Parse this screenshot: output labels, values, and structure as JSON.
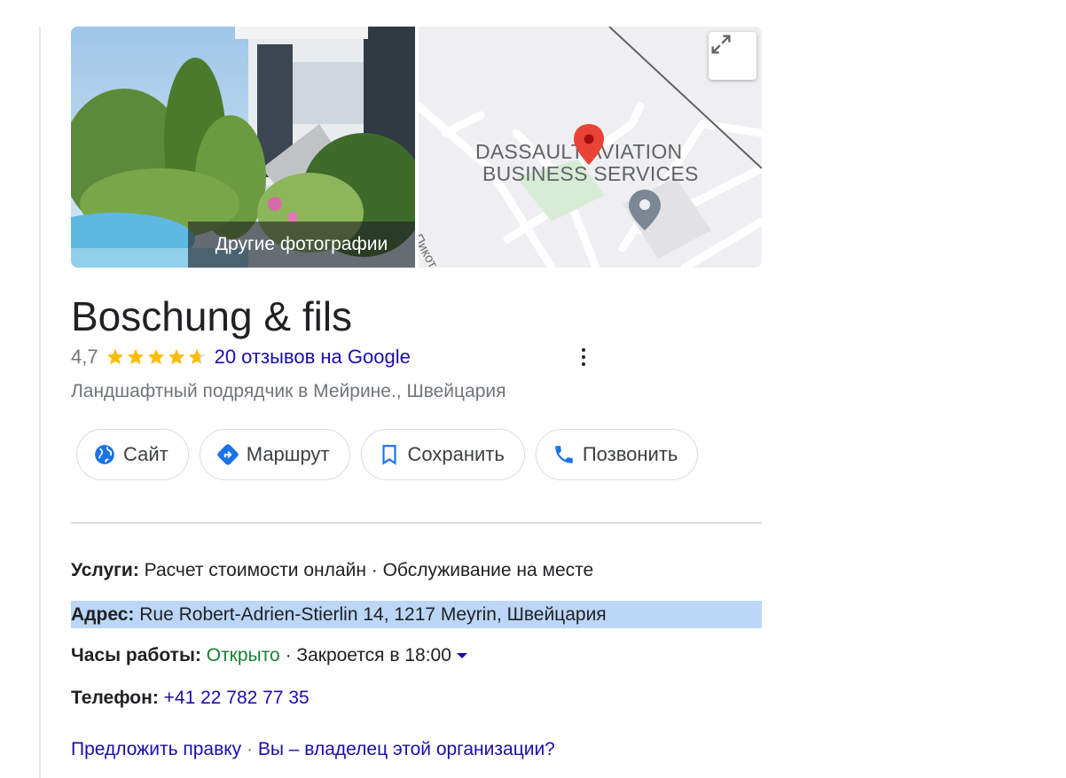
{
  "photo": {
    "label": "Другие фотографии"
  },
  "map": {
    "label_line1": "DASSAULT AVIATION",
    "label_line2": "BUSINESS SERVICES",
    "street": "ул. Пикот",
    "pin_color": "#ea4335"
  },
  "business": {
    "name": "Boschung & fils",
    "rating": "4,7",
    "stars_value": 4.7,
    "reviews": "20 отзывов на Google",
    "category": "Ландшафтный подрядчик в Мейрине., Швейцария"
  },
  "actions": {
    "site": "Сайт",
    "route": "Маршрут",
    "save": "Сохранить",
    "call": "Позвонить"
  },
  "details": {
    "services_label": "Услуги:",
    "services_value": "Расчет стоимости онлайн · Обслуживание на месте",
    "address_label": "Адрес:",
    "address_value": "Rue Robert-Adrien-Stierlin 14, 1217 Meyrin, Швейцария",
    "hours_label": "Часы работы:",
    "hours_open": "Открыто",
    "hours_close": "· Закроется в 18:00",
    "phone_label": "Телефон:",
    "phone_value": "+41 22 782 77 35"
  },
  "footer": {
    "suggest": "Предложить правку",
    "sep": "·",
    "owner": "Вы – владелец этой организации?"
  },
  "colors": {
    "link": "#1a0dab",
    "open": "#188038",
    "star": "#fbbc04",
    "highlight": "#bcd6f7",
    "icon_blue": "#1a73e8"
  }
}
